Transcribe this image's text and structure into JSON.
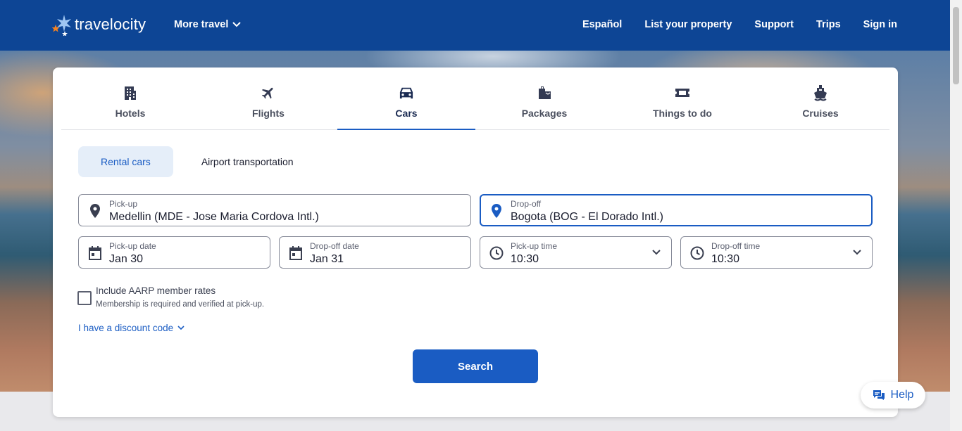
{
  "header": {
    "logo_text": "travelocity",
    "more_travel": "More travel",
    "nav": [
      "Español",
      "List your property",
      "Support",
      "Trips",
      "Sign in"
    ]
  },
  "tabs": [
    {
      "label": "Hotels",
      "icon": "hotel-icon"
    },
    {
      "label": "Flights",
      "icon": "plane-icon"
    },
    {
      "label": "Cars",
      "icon": "car-icon",
      "active": true
    },
    {
      "label": "Packages",
      "icon": "suitcase-icon"
    },
    {
      "label": "Things to do",
      "icon": "ticket-icon"
    },
    {
      "label": "Cruises",
      "icon": "ship-icon"
    }
  ],
  "subtabs": {
    "rental": "Rental cars",
    "airport": "Airport transportation"
  },
  "pickup": {
    "label": "Pick-up",
    "value": "Medellin (MDE - Jose Maria Cordova Intl.)"
  },
  "dropoff": {
    "label": "Drop-off",
    "value": "Bogota (BOG - El Dorado Intl.)"
  },
  "pickup_date": {
    "label": "Pick-up date",
    "value": "Jan 30"
  },
  "dropoff_date": {
    "label": "Drop-off date",
    "value": "Jan 31"
  },
  "pickup_time": {
    "label": "Pick-up time",
    "value": "10:30"
  },
  "dropoff_time": {
    "label": "Drop-off time",
    "value": "10:30"
  },
  "aarp": {
    "label": "Include AARP member rates",
    "sub": "Membership is required and verified at pick-up.",
    "checked": false
  },
  "discount": "I have a discount code",
  "search": "Search",
  "help": "Help",
  "colors": {
    "brand": "#0d4595",
    "accent": "#1a5cc3",
    "logo_orange": "#f58220"
  }
}
